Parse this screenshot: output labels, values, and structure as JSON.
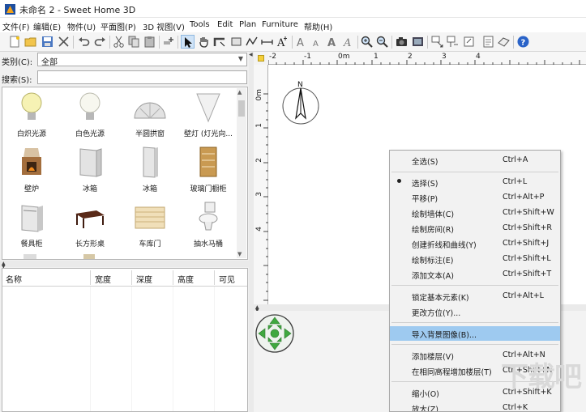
{
  "window": {
    "title": "未命名 2 - Sweet Home 3D"
  },
  "menubar": {
    "items": [
      "文件(F)",
      "编辑(E)",
      "物件(U)",
      "平面图(P)",
      "3D 视图(V)",
      "Tools",
      "Edit",
      "Plan",
      "Furniture",
      "帮助(H)"
    ]
  },
  "catalog": {
    "category_label": "类别(C):",
    "category_value": "全部",
    "search_label": "搜索(S):",
    "search_value": "",
    "items": [
      {
        "label": "白炽光源",
        "icon": "bulb-icon"
      },
      {
        "label": "白色光源",
        "icon": "bulb-icon"
      },
      {
        "label": "半圆拱窗",
        "icon": "arch-window-icon"
      },
      {
        "label": "壁灯 (灯光向...",
        "icon": "cone-lamp-icon"
      },
      {
        "label": "壁炉",
        "icon": "fireplace-icon"
      },
      {
        "label": "冰箱",
        "icon": "fridge-icon"
      },
      {
        "label": "冰箱",
        "icon": "fridge-tall-icon"
      },
      {
        "label": "玻璃门橱柜",
        "icon": "glass-cabinet-icon"
      },
      {
        "label": "餐具柜",
        "icon": "dishwasher-icon"
      },
      {
        "label": "长方形桌",
        "icon": "table-icon"
      },
      {
        "label": "车库门",
        "icon": "garage-door-icon"
      },
      {
        "label": "抽水马桶",
        "icon": "toilet-icon"
      }
    ]
  },
  "furniture_table": {
    "columns": [
      "名称",
      "宽度",
      "深度",
      "高度",
      "可见"
    ]
  },
  "plan": {
    "ruler_top": [
      "-2",
      "-1",
      "0m",
      "1",
      "2",
      "3",
      "4"
    ],
    "ruler_left": [
      "0m",
      "1",
      "2",
      "3",
      "4"
    ],
    "compass_label": "N"
  },
  "context_menu": {
    "items": [
      {
        "label": "全选(S)",
        "shortcut": "Ctrl+A"
      },
      {
        "label": "选择(S)",
        "shortcut": "Ctrl+L",
        "checked": true
      },
      {
        "label": "平移(P)",
        "shortcut": "Ctrl+Alt+P"
      },
      {
        "label": "绘制墙体(C)",
        "shortcut": "Ctrl+Shift+W"
      },
      {
        "label": "绘制房间(R)",
        "shortcut": "Ctrl+Shift+R"
      },
      {
        "label": "创建折线和曲线(Y)",
        "shortcut": "Ctrl+Shift+J"
      },
      {
        "label": "绘制标注(E)",
        "shortcut": "Ctrl+Shift+L"
      },
      {
        "label": "添加文本(A)",
        "shortcut": "Ctrl+Shift+T"
      },
      {
        "label": "锁定基本元素(K)",
        "shortcut": "Ctrl+Alt+L"
      },
      {
        "label": "更改方位(Y)...",
        "shortcut": ""
      },
      {
        "label": "导入背景图像(B)...",
        "shortcut": "",
        "highlighted": true
      },
      {
        "label": "添加楼层(V)",
        "shortcut": "Ctrl+Alt+N"
      },
      {
        "label": "在相同高程增加楼层(T)",
        "shortcut": "Ctrl+Shift+N"
      },
      {
        "label": "缩小(O)",
        "shortcut": "Ctrl+Shift+K"
      },
      {
        "label": "放大(Z)",
        "shortcut": "Ctrl+K"
      }
    ]
  },
  "watermark": "下载吧",
  "colors": {
    "highlight": "#9ecaf0",
    "selected_tool": "#cfe3f7",
    "navpad_green": "#3fa83f"
  }
}
